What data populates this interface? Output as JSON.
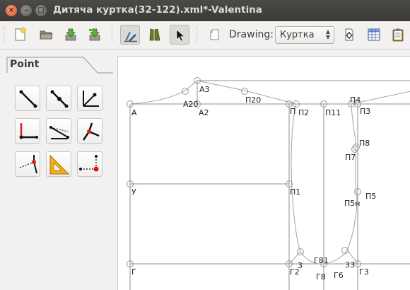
{
  "window": {
    "title": "Дитяча куртка(32-122).xml*-Valentina",
    "close_glyph": "×",
    "minimize_glyph": "–",
    "maximize_glyph": "□"
  },
  "toolbar": {
    "drawing_label": "Drawing:",
    "drawing_value": "Куртка",
    "pressed_tool": "arrow-pointer"
  },
  "panel": {
    "tab_label": "Point",
    "tools": [
      "point-at-distance-angle",
      "point-along-line",
      "point-along-bisector",
      "point-at-normal",
      "point-at-perpendicular",
      "point-at-shoulder",
      "point-at-triangle",
      "point-of-contact",
      "point-intersect-xy"
    ]
  },
  "canvas": {
    "point_labels": {
      "A": "А",
      "A20": "А20",
      "A2": "А2",
      "A3": "А3",
      "P20": "П20",
      "P": "П",
      "P2": "П2",
      "P11": "П11",
      "P4": "П4",
      "P3": "П3",
      "P8": "П8",
      "P7": "П7",
      "P5": "П5",
      "P5n": "П5н",
      "U": "У",
      "P1": "П1",
      "G": "Г",
      "G2": "Г2",
      "p3": "3",
      "G81": "Г81",
      "G8": "Г8",
      "G6": "Г6",
      "p33": "33",
      "G3": "Г3"
    }
  }
}
